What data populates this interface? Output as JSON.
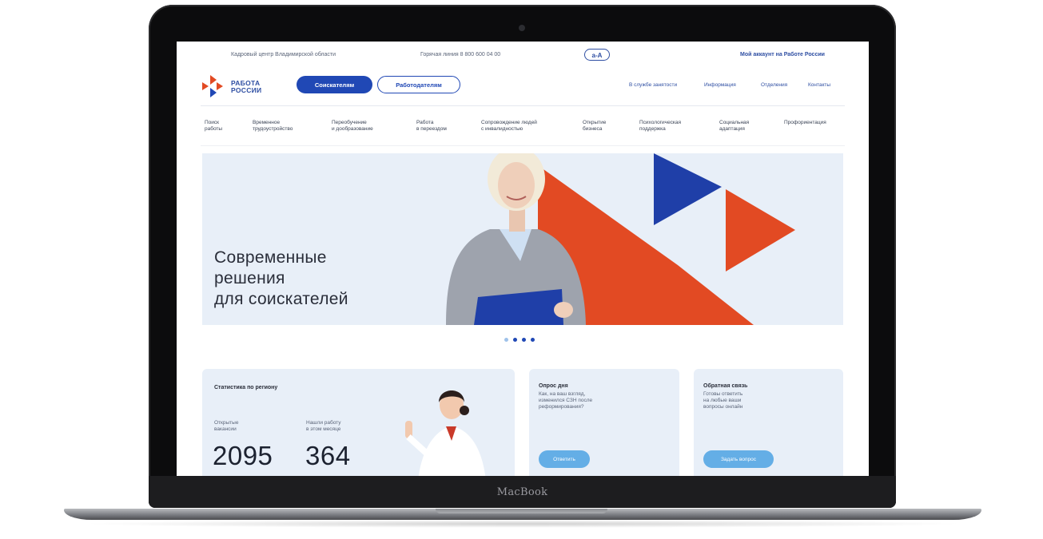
{
  "device": {
    "brand_label": "MacBook"
  },
  "topbar": {
    "center_name": "Кадровый центр Владимирской области",
    "hotline": "Горячая линия 8 800 600 04 00",
    "font_toggle": "a-A",
    "account_link": "Мой аккаунт на Работе России"
  },
  "header": {
    "logo_text": "РАБОТА\nРОССИИ",
    "seekers_button": "Соискателям",
    "employers_button": "Работодателям",
    "links": [
      "В службе занятости",
      "Информация",
      "Отделения",
      "Контакты"
    ]
  },
  "menu": {
    "items": [
      "Поиск\nработы",
      "Временное\nтрудоустройство",
      "Переобучение\nи дообразование",
      "Работа\nв переездом",
      "Сопровождение людей\nс инвалидностью",
      "Открытие\nбизнеса",
      "Психологическая\nподдержка",
      "Социальная\nадаптация",
      "Профориентация"
    ]
  },
  "hero": {
    "title": "Современные\nрешения\nдля соискателей",
    "slides_total": 4,
    "active_slide": 1
  },
  "stats": {
    "title": "Статистика по региону",
    "vacancies_label": "Открытые\nвакансии",
    "vacancies_value": "2095",
    "found_label": "Нашли работу\nв этом месяце",
    "found_value": "364"
  },
  "poll": {
    "title": "Опрос дня",
    "text": "Как, на ваш взгляд,\nизменился СЗН после\nреформирования?",
    "button": "Ответить"
  },
  "feedback": {
    "title": "Обратная связь",
    "text": "Готовы ответить\nна любые ваши\nвопросы онлайн",
    "button": "Задать вопрос"
  },
  "colors": {
    "brand_blue": "#2048b5",
    "brand_red": "#e24a23",
    "hero_bg": "#e8eff8",
    "button_light_blue": "#64aee6"
  }
}
